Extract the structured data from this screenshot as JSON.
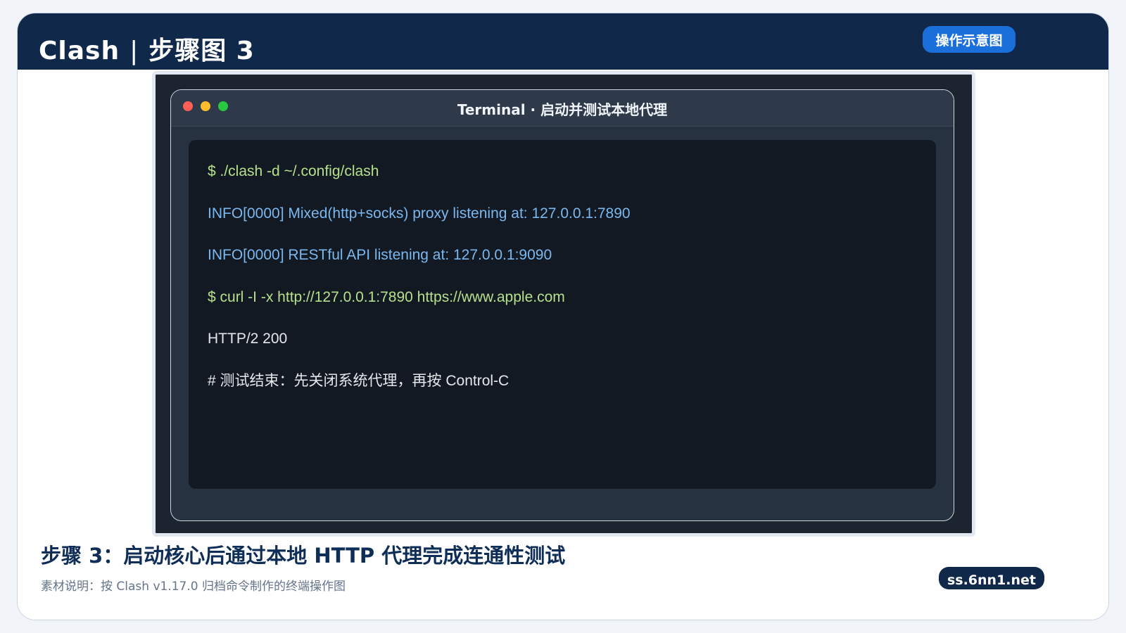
{
  "header": {
    "app_name": "Clash",
    "separator": "|",
    "step_title": "步骤图 3",
    "badge": "操作示意图"
  },
  "terminal": {
    "title": "Terminal · 启动并测试本地代理",
    "lines": [
      "$ ./clash -d ~/.config/clash",
      "INFO[0000] Mixed(http+socks) proxy listening at: 127.0.0.1:7890",
      "INFO[0000] RESTful API listening at: 127.0.0.1:9090",
      "$ curl -I -x http://127.0.0.1:7890 https://www.apple.com",
      "HTTP/2 200",
      "# 测试结束：先关闭系统代理，再按 Control-C"
    ]
  },
  "caption": {
    "title": "步骤 3：启动核心后通过本地 HTTP 代理完成连通性测试",
    "note": "素材说明：按 Clash v1.17.0 归档命令制作的终端操作图"
  },
  "site_badge": "ss.6nn1.net",
  "colors": {
    "header_bg": "#10284a",
    "accent_blue": "#1a6fdb",
    "command_green": "#b6e08c",
    "info_blue": "#7ab8f0",
    "traffic_red": "#ff5f57",
    "traffic_yellow": "#febc2e",
    "traffic_green": "#28c840"
  },
  "icons": {
    "window_close": "traffic-light-red",
    "window_minimize": "traffic-light-yellow",
    "window_zoom": "traffic-light-green"
  }
}
